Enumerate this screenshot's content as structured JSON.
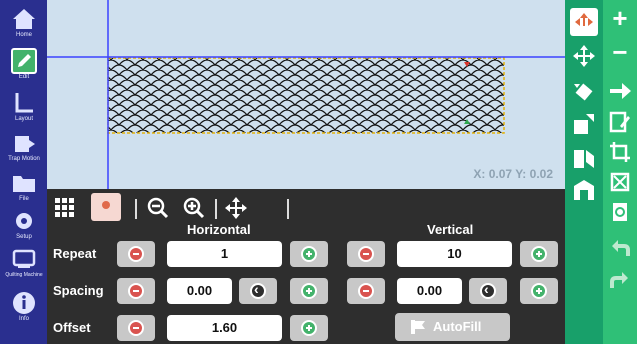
{
  "sidebar": {
    "items": [
      {
        "label": "Home",
        "icon": "home-icon"
      },
      {
        "label": "Edit",
        "icon": "edit-icon"
      },
      {
        "label": "Layout",
        "icon": "layout-icon"
      },
      {
        "label": "Trap Motion",
        "icon": "trap-motion-icon"
      },
      {
        "label": "File",
        "icon": "folder-icon"
      },
      {
        "label": "Setup",
        "icon": "settings-icon"
      },
      {
        "label": "Quilting Machine",
        "icon": "machine-icon"
      },
      {
        "label": "Info",
        "icon": "info-icon"
      }
    ]
  },
  "canvas": {
    "coords": "X: 0.07 Y: 0.02",
    "colors": {
      "background": "#cfe0ee",
      "crosshair": "#3b42ff",
      "pattern_border": "#e3b30f"
    }
  },
  "panel": {
    "tools": [
      "grid-icon",
      "pattern-thumbnail-icon",
      "zoom-out-icon",
      "zoom-in-icon",
      "move-icon"
    ],
    "headers": {
      "horizontal": "Horizontal",
      "vertical": "Vertical"
    },
    "rows": {
      "repeat": {
        "label": "Repeat",
        "horizontal": "1",
        "vertical": "10"
      },
      "spacing": {
        "label": "Spacing",
        "horizontal": "0.00",
        "vertical": "0.00"
      },
      "offset": {
        "label": "Offset",
        "horizontal": "1.60"
      }
    },
    "autofill": "AutoFill"
  },
  "right_tools": [
    "select-tool-icon",
    "move-tool-icon",
    "rotate-tool-icon",
    "resize-tool-icon",
    "flip-tool-icon",
    "mirror-tool-icon"
  ],
  "right_actions": [
    "add-icon",
    "remove-icon",
    "next-icon",
    "edit-doc-icon",
    "crop-icon",
    "split-icon",
    "refresh-icon",
    "undo-icon",
    "redo-icon"
  ]
}
